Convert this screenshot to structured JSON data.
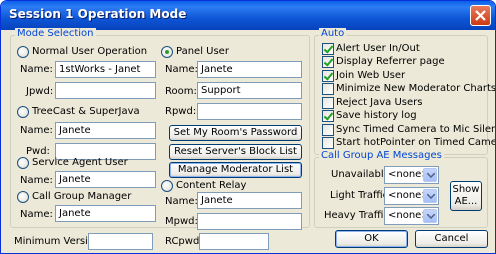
{
  "window": {
    "title": "Session 1 Operation Mode"
  },
  "mode_selection": {
    "title": "Mode Selection",
    "normal_user": {
      "label": "Normal User Operation",
      "name_label": "Name:",
      "name_value": "1stWorks - Janet",
      "jpwd_label": "Jpwd:",
      "jpwd_value": ""
    },
    "treecast": {
      "label": "TreeCast & SuperJava",
      "name_label": "Name:",
      "name_value": "Janete",
      "pwd_label": "Pwd:",
      "pwd_value": ""
    },
    "service_agent": {
      "label": "Service Agent User",
      "name_label": "Name:",
      "name_value": "Janete"
    },
    "call_group": {
      "label": "Call Group Manager",
      "name_label": "Name:",
      "name_value": "Janete"
    },
    "panel_user": {
      "label": "Panel User",
      "name_label": "Name:",
      "name_value": "Janete",
      "room_label": "Room:",
      "room_value": "Support",
      "rpwd_label": "Rpwd:",
      "rpwd_value": ""
    },
    "buttons": {
      "set_password": "Set My Room's Password",
      "reset_block": "Reset Server's Block List",
      "manage_moderator": "Manage Moderator List"
    },
    "content_relay": {
      "label": "Content Relay",
      "name_label": "Name:",
      "name_value": "Janete",
      "mpwd_label": "Mpwd:",
      "mpwd_value": ""
    }
  },
  "auto": {
    "title": "Auto",
    "options": [
      {
        "label": "Alert User In/Out",
        "checked": true
      },
      {
        "label": "Display Referrer page",
        "checked": true
      },
      {
        "label": "Join Web User",
        "checked": true
      },
      {
        "label": "Minimize New Moderator Charts",
        "checked": false
      },
      {
        "label": "Reject Java Users",
        "checked": false
      },
      {
        "label": "Save history log",
        "checked": true
      },
      {
        "label": "Sync Timed Camera to Mic Silence",
        "checked": false
      },
      {
        "label": "Start hotPointer on Timed Camera",
        "checked": false
      }
    ]
  },
  "call_group_messages": {
    "title": "Call Group AE Messages",
    "unavailable_label": "Unavailable:",
    "unavailable_value": "<none>",
    "light_label": "Light Traffic:",
    "light_value": "<none>",
    "heavy_label": "Heavy Traffic:",
    "heavy_value": "<none>",
    "show_label_line1": "Show",
    "show_label_line2": "AE..."
  },
  "footer": {
    "min_version_label": "Minimum Version:",
    "min_version_value": "",
    "rcpwd_label": "RCpwd:",
    "rcpwd_value": "",
    "ok_label": "OK",
    "cancel_label": "Cancel"
  }
}
